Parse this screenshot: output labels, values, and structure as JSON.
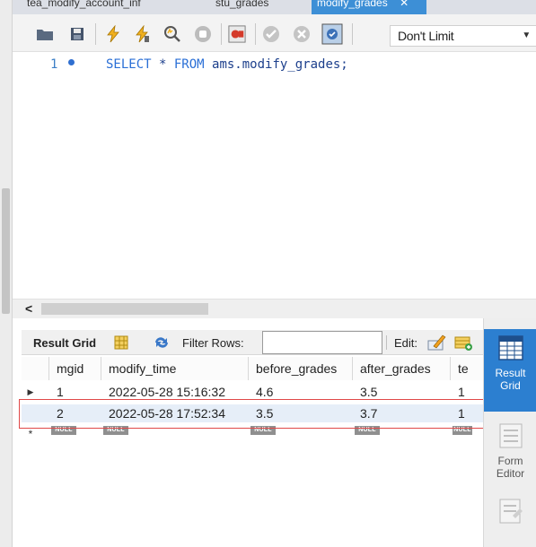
{
  "tabs": [
    {
      "label": "tea_modify_account_inf",
      "active": false
    },
    {
      "label": "stu_grades",
      "active": false
    },
    {
      "label": "modify_grades",
      "active": true
    }
  ],
  "toolbar": {
    "icons": [
      "folder-icon",
      "save-icon",
      "execute-icon",
      "execute-current-icon",
      "explain-icon",
      "stop-icon",
      "toggle-error-icon",
      "commit-icon",
      "rollback-icon",
      "autocommit-icon"
    ],
    "limit_value": "Don't Limit"
  },
  "editor": {
    "line_number": "1",
    "sql_keyword_select": "SELECT",
    "sql_star": " * ",
    "sql_keyword_from": "FROM",
    "sql_rest": " ams.modify_grades;"
  },
  "result_toolbar": {
    "title": "Result Grid",
    "filter_label": "Filter Rows:",
    "filter_value": "",
    "edit_label": "Edit:"
  },
  "grid": {
    "columns": [
      "mgid",
      "modify_time",
      "before_grades",
      "after_grades",
      "te"
    ],
    "rows": [
      [
        "1",
        "2022-05-28 15:16:32",
        "4.6",
        "3.5",
        "1"
      ],
      [
        "2",
        "2022-05-28 17:52:34",
        "3.5",
        "3.7",
        "1"
      ]
    ],
    "null_label": "NULL"
  },
  "side_panel": {
    "result_grid_label_1": "Result",
    "result_grid_label_2": "Grid",
    "form_editor_label_1": "Form",
    "form_editor_label_2": "Editor"
  },
  "colors": {
    "active_tab": "#3d8fd6",
    "active_side": "#2c7fd0",
    "highlight_border": "#e04848"
  }
}
